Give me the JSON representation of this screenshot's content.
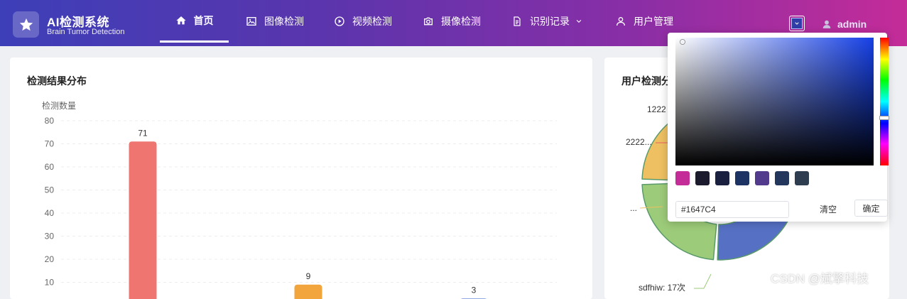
{
  "brand": {
    "title": "AI检测系统",
    "subtitle": "Brain Tumor Detection"
  },
  "nav": [
    {
      "label": "首页",
      "icon": "home-icon",
      "active": true
    },
    {
      "label": "图像检测",
      "icon": "image-icon"
    },
    {
      "label": "视频检测",
      "icon": "play-circle-icon"
    },
    {
      "label": "摄像检测",
      "icon": "camera-icon"
    },
    {
      "label": "识别记录",
      "icon": "document-icon",
      "dropdown": true
    },
    {
      "label": "用户管理",
      "icon": "user-icon"
    }
  ],
  "user": {
    "name": "admin"
  },
  "left_card": {
    "title": "检测结果分布"
  },
  "right_card": {
    "title": "用户检测分"
  },
  "chart_data": [
    {
      "type": "bar",
      "ylabel": "检测数量",
      "ylim": [
        0,
        80
      ],
      "yticks": [
        80,
        70,
        60,
        50,
        40,
        30,
        20,
        10
      ],
      "values": [
        71,
        9,
        3
      ],
      "data_labels": [
        "71",
        "9",
        "3"
      ],
      "colors": [
        "#ef7571",
        "#f2a53c",
        "#6c8fdc"
      ]
    },
    {
      "type": "pie",
      "labels": [
        "1222",
        "2222...",
        "...",
        "sdfhiw: 17次"
      ],
      "colors": [
        "#eec061",
        "#9ccb79",
        "#5670c4",
        "#e85f62"
      ]
    }
  ],
  "color_picker": {
    "hex_value": "#1647C4",
    "clear_label": "清空",
    "confirm_label": "确定",
    "swatches": [
      "#c42c98",
      "#1c1b2e",
      "#1a2140",
      "#1c3363",
      "#523a8c",
      "#23375c",
      "#2e3d4f"
    ]
  },
  "watermark": "CSDN @斌擎科技"
}
